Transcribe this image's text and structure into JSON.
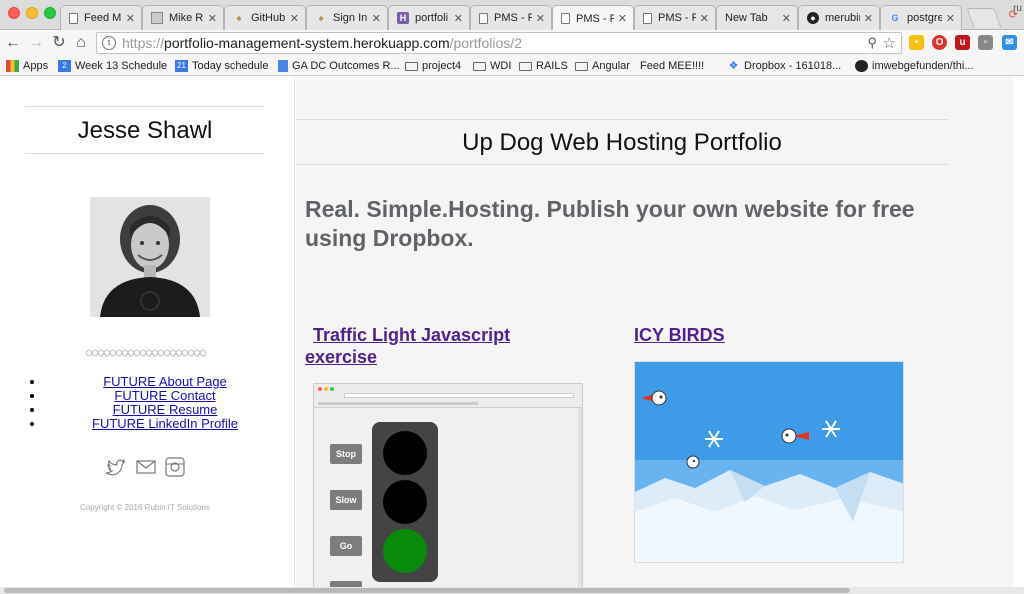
{
  "browser": {
    "tabs": [
      {
        "title": "Feed M",
        "icon": "document-icon"
      },
      {
        "title": "Mike Ru",
        "icon": "image-icon"
      },
      {
        "title": "GitHub",
        "icon": "wizard-hat-icon"
      },
      {
        "title": "Sign In",
        "icon": "wizard-hat-icon"
      },
      {
        "title": "portfoli",
        "icon": "heroku-icon"
      },
      {
        "title": "PMS - R",
        "icon": "document-icon"
      },
      {
        "title": "PMS - R",
        "icon": "document-icon"
      },
      {
        "title": "PMS - R",
        "icon": "document-icon"
      },
      {
        "title": "New Tab",
        "icon": "none"
      },
      {
        "title": "merubin",
        "icon": "github-icon"
      },
      {
        "title": "postgre",
        "icon": "google-icon"
      },
      {
        "title": "ru",
        "icon": "none"
      }
    ],
    "active_tab_index": 6,
    "url": {
      "protocol": "https://",
      "host": "portfolio-management-system.herokuapp.com",
      "path": "/portfolios/2"
    },
    "bookmarks": [
      {
        "label": "Apps",
        "icon": "apps-icon"
      },
      {
        "label": "Week 13 Schedule",
        "icon": "calendar-icon",
        "icon_text": "2"
      },
      {
        "label": "Today schedule",
        "icon": "calendar-icon",
        "icon_text": "21"
      },
      {
        "label": "GA DC Outcomes R...",
        "icon": "docs-icon"
      },
      {
        "label": "project4",
        "icon": "folder-icon"
      },
      {
        "label": "WDI",
        "icon": "folder-icon"
      },
      {
        "label": "RAILS",
        "icon": "folder-icon"
      },
      {
        "label": "Angular",
        "icon": "folder-icon"
      },
      {
        "label": "Feed MEE!!!!",
        "icon": "page-icon"
      },
      {
        "label": "Dropbox - 161018...",
        "icon": "dropbox-icon"
      },
      {
        "label": "imwebgefunden/thi...",
        "icon": "github-icon"
      }
    ]
  },
  "sidebar": {
    "author": "Jesse Shawl",
    "links": [
      {
        "label": "FUTURE About Page"
      },
      {
        "label": "FUTURE Contact"
      },
      {
        "label": "FUTURE Resume"
      },
      {
        "label": "FUTURE LinkedIn Profile"
      }
    ],
    "social": [
      "twitter-icon",
      "email-icon",
      "instagram-icon"
    ],
    "copyright": "Copyright © 2016 Rubin IT Solutions"
  },
  "main": {
    "title": "Up Dog Web Hosting Portfolio",
    "tagline": "Real. Simple.Hosting. Publish your own website for free using Dropbox.",
    "projects": [
      {
        "title": "Traffic Light Javascript exercise",
        "thumb_buttons": [
          "Stop",
          "Slow",
          "Go"
        ]
      },
      {
        "title": "ICY BIRDS"
      }
    ]
  },
  "colors": {
    "link": "#1a0dab",
    "project_link": "#51218f",
    "tagline": "#606468",
    "main_bg": "#f5f5f5",
    "sky": "#3d9be8",
    "light_green": "#0a8a0a"
  }
}
